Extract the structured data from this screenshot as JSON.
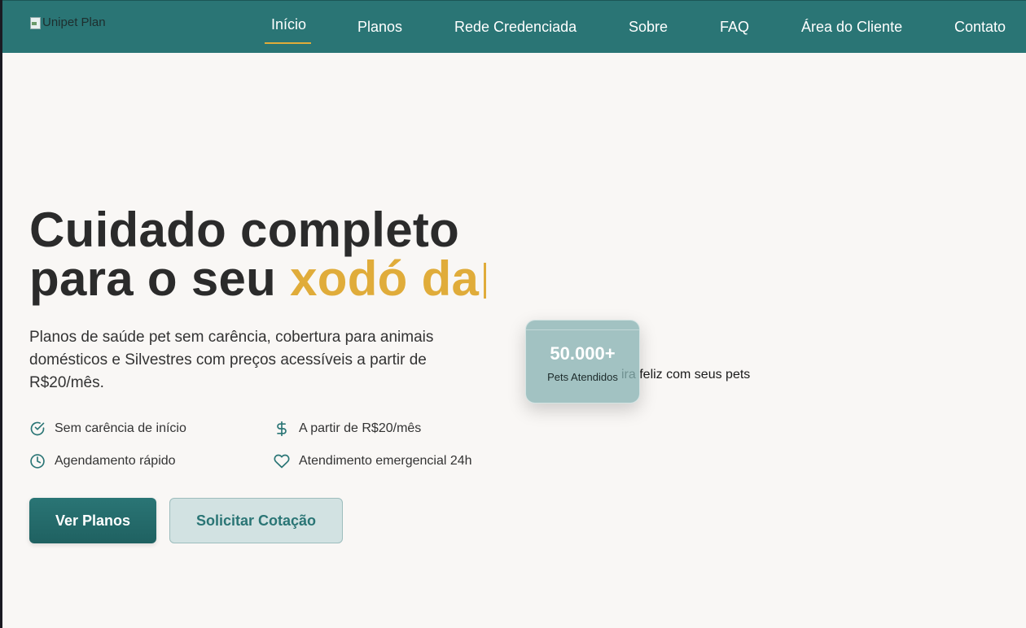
{
  "header": {
    "logo_alt": "Unipet Plan",
    "nav": [
      {
        "label": "Início",
        "active": true
      },
      {
        "label": "Planos"
      },
      {
        "label": "Rede Credenciada"
      },
      {
        "label": "Sobre"
      },
      {
        "label": "FAQ"
      },
      {
        "label": "Área do Cliente"
      },
      {
        "label": "Contato"
      }
    ]
  },
  "hero": {
    "title_line1": "Cuidado completo",
    "title_line2_prefix": "para o seu ",
    "title_line2_accent": "xodó da",
    "subtitle": "Planos de saúde pet sem carência, cobertura para animais domésticos e Silvestres com preços acessíveis a partir de R$20/mês.",
    "features": [
      {
        "icon": "check-circle-icon",
        "label": "Sem carência de início"
      },
      {
        "icon": "dollar-icon",
        "label": "A partir de R$20/mês"
      },
      {
        "icon": "clock-icon",
        "label": "Agendamento rápido"
      },
      {
        "icon": "heart-icon",
        "label": "Atendimento emergencial 24h"
      }
    ],
    "primary_button": "Ver Planos",
    "secondary_button": "Solicitar Cotação"
  },
  "stat_card": {
    "value": "50.000+",
    "label": "Pets Atendidos"
  },
  "tagline_partial": "ira feliz com seus pets",
  "colors": {
    "primary": "#2a7575",
    "accent": "#e0ac3a",
    "background": "#f9f7f5"
  }
}
